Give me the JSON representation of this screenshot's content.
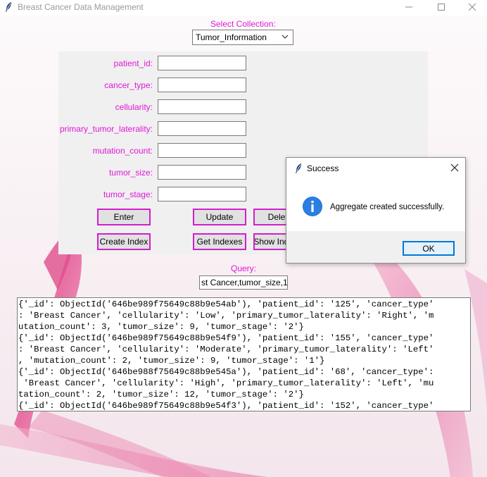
{
  "window": {
    "title": "Breast Cancer Data Management",
    "icon": "feather-icon"
  },
  "collection": {
    "label": "Select Collection:",
    "selected": "Tumor_Information"
  },
  "form": {
    "fields": [
      {
        "label": "patient_id:",
        "value": ""
      },
      {
        "label": "cancer_type:",
        "value": ""
      },
      {
        "label": "cellularity:",
        "value": ""
      },
      {
        "label": "primary_tumor_laterality:",
        "value": ""
      },
      {
        "label": "mutation_count:",
        "value": ""
      },
      {
        "label": "tumor_size:",
        "value": ""
      },
      {
        "label": "tumor_stage:",
        "value": ""
      }
    ],
    "buttons": {
      "enter": "Enter",
      "update": "Update",
      "delete": "Delete",
      "create_index": "Create Index",
      "get_indexes": "Get Indexes",
      "show_indexes": "Show Indexes"
    }
  },
  "query": {
    "label": "Query:",
    "value": "st Cancer,tumor_size,1"
  },
  "output": {
    "lines": [
      "{'_id': ObjectId('646be989f75649c88b9e54ab'), 'patient_id': '125', 'cancer_type'",
      ": 'Breast Cancer', 'cellularity': 'Low', 'primary_tumor_laterality': 'Right', 'm",
      "utation_count': 3, 'tumor_size': 9, 'tumor_stage': '2'}",
      "{'_id': ObjectId('646be989f75649c88b9e54f9'), 'patient_id': '155', 'cancer_type'",
      ": 'Breast Cancer', 'cellularity': 'Moderate', 'primary_tumor_laterality': 'Left'",
      ", 'mutation_count': 2, 'tumor_size': 9, 'tumor_stage': '1'}",
      "{'_id': ObjectId('646be988f75649c88b9e545a'), 'patient_id': '68', 'cancer_type':",
      " 'Breast Cancer', 'cellularity': 'High', 'primary_tumor_laterality': 'Left', 'mu",
      "tation_count': 2, 'tumor_size': 12, 'tumor_stage': '2'}",
      "{'_id': ObjectId('646be989f75649c88b9e54f3'), 'patient_id': '152', 'cancer_type'"
    ]
  },
  "dialog": {
    "title": "Success",
    "message": "Aggregate created successfully.",
    "ok_label": "OK",
    "icon": "info-icon"
  },
  "colors": {
    "accent_label": "#e018d8",
    "button_border": "#d41ecd",
    "dialog_button_border": "#0078d7",
    "ribbon": "#e8609a"
  }
}
